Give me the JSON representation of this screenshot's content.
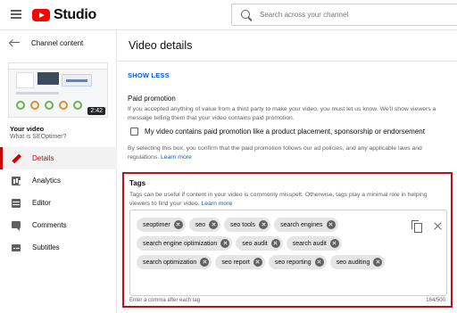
{
  "topbar": {
    "brand": "Studio",
    "search_placeholder": "Search across your channel"
  },
  "sidebar": {
    "back_label": "Channel content",
    "thumbnail_duration": "2:42",
    "your_video_label": "Your video",
    "video_title": "What is SEOptimer?",
    "items": [
      {
        "label": "Details",
        "icon": "pencil-icon",
        "active": true
      },
      {
        "label": "Analytics",
        "icon": "analytics-icon",
        "active": false
      },
      {
        "label": "Editor",
        "icon": "editor-icon",
        "active": false
      },
      {
        "label": "Comments",
        "icon": "comments-icon",
        "active": false
      },
      {
        "label": "Subtitles",
        "icon": "subtitles-icon",
        "active": false
      }
    ]
  },
  "main": {
    "title": "Video details",
    "show_less": "SHOW LESS",
    "paid_promotion": {
      "title": "Paid promotion",
      "description": "If you accepted anything of value from a third party to make your video, you must let us know. We'll show viewers a message telling them that your video contains paid promotion.",
      "checkbox_label": "My video contains paid promotion like a product placement, sponsorship or endorsement",
      "checked": false,
      "note": "By selecting this box, you confirm that the paid promotion follows our ad policies, and any applicable laws and regulations.",
      "note_link": "Learn more"
    },
    "tags": {
      "title": "Tags",
      "description": "Tags can be useful if content in your video is commonly misspelt. Otherwise, tags play a minimal role in helping viewers to find your video.",
      "description_link": "Learn more",
      "rows": [
        [
          "seoptimer",
          "seo",
          "seo tools",
          "search engines"
        ],
        [
          "search engine optimization",
          "seo audit",
          "search audit"
        ],
        [
          "search optimization",
          "seo report",
          "seo reporting",
          "seo auditing"
        ]
      ],
      "hint": "Enter a comma after each tag",
      "count": "164/500"
    }
  },
  "colors": {
    "accent_red": "#cc0000",
    "link_blue": "#065fd4",
    "highlight_border": "#b5121b"
  }
}
